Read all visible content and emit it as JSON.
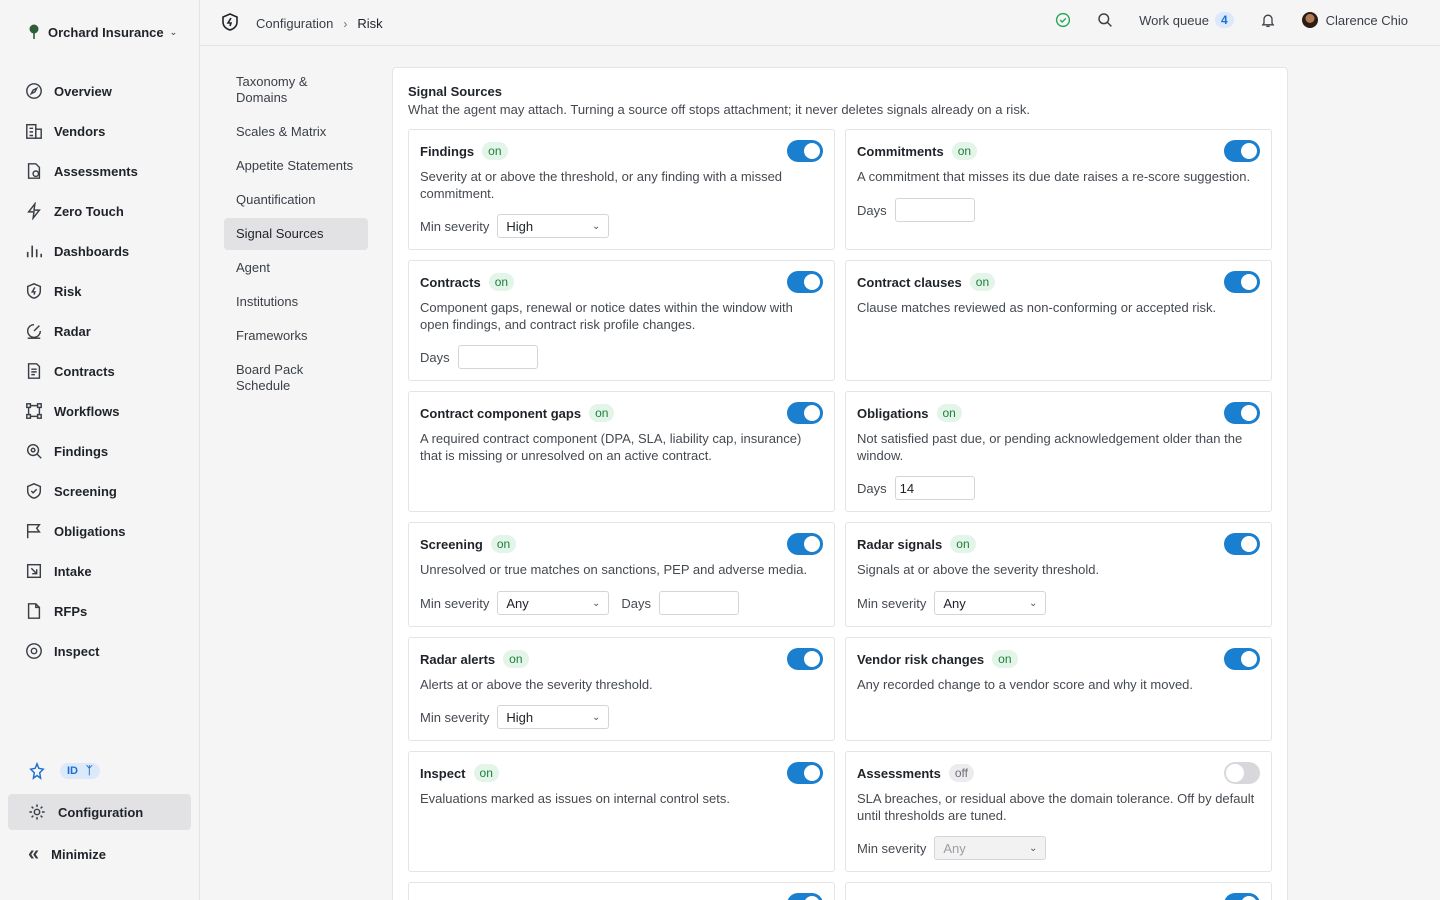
{
  "org": {
    "name": "Orchard Insurance"
  },
  "nav": [
    {
      "label": "Overview",
      "icon": "compass-icon"
    },
    {
      "label": "Vendors",
      "icon": "building-icon"
    },
    {
      "label": "Assessments",
      "icon": "document-check-icon"
    },
    {
      "label": "Zero Touch",
      "icon": "bolt-icon"
    },
    {
      "label": "Dashboards",
      "icon": "bar-chart-icon"
    },
    {
      "label": "Risk",
      "icon": "shield-bolt-icon"
    },
    {
      "label": "Radar",
      "icon": "radar-icon"
    },
    {
      "label": "Contracts",
      "icon": "contract-icon"
    },
    {
      "label": "Workflows",
      "icon": "workflow-icon"
    },
    {
      "label": "Findings",
      "icon": "magnifier-icon"
    },
    {
      "label": "Screening",
      "icon": "shield-check-icon"
    },
    {
      "label": "Obligations",
      "icon": "flag-icon"
    },
    {
      "label": "Intake",
      "icon": "intake-icon"
    },
    {
      "label": "RFPs",
      "icon": "file-icon"
    },
    {
      "label": "Inspect",
      "icon": "eye-icon"
    }
  ],
  "footer": {
    "id_badge": "ID",
    "configuration": "Configuration",
    "minimize": "Minimize"
  },
  "breadcrumb": {
    "parent": "Configuration",
    "current": "Risk"
  },
  "topbar": {
    "work_queue": "Work queue",
    "work_queue_count": "4",
    "user_name": "Clarence Chio"
  },
  "subnav": [
    {
      "label": "Taxonomy & Domains",
      "active": false
    },
    {
      "label": "Scales & Matrix",
      "active": false
    },
    {
      "label": "Appetite Statements",
      "active": false
    },
    {
      "label": "Quantification",
      "active": false
    },
    {
      "label": "Signal Sources",
      "active": true
    },
    {
      "label": "Agent",
      "active": false
    },
    {
      "label": "Institutions",
      "active": false
    },
    {
      "label": "Frameworks",
      "active": false
    },
    {
      "label": "Board Pack Schedule",
      "active": false
    }
  ],
  "panel": {
    "title": "Signal Sources",
    "description": "What the agent may attach. Turning a source off stops attachment; it never deletes signals already on a risk."
  },
  "labels": {
    "min_severity": "Min severity",
    "days": "Days"
  },
  "cards": {
    "findings": {
      "title": "Findings",
      "status": "on",
      "description": "Severity at or above the threshold, or any finding with a missed commitment.",
      "min_severity": "High"
    },
    "commitments": {
      "title": "Commitments",
      "status": "on",
      "description": "A commitment that misses its due date raises a re-score suggestion.",
      "days": ""
    },
    "contracts": {
      "title": "Contracts",
      "status": "on",
      "description": "Component gaps, renewal or notice dates within the window with open findings, and contract risk profile changes.",
      "days": ""
    },
    "contract_clauses": {
      "title": "Contract clauses",
      "status": "on",
      "description": "Clause matches reviewed as non-conforming or accepted risk."
    },
    "contract_component_gaps": {
      "title": "Contract component gaps",
      "status": "on",
      "description": "A required contract component (DPA, SLA, liability cap, insurance) that is missing or unresolved on an active contract."
    },
    "obligations": {
      "title": "Obligations",
      "status": "on",
      "description": "Not satisfied past due, or pending acknowledgement older than the window.",
      "days": "14"
    },
    "screening": {
      "title": "Screening",
      "status": "on",
      "description": "Unresolved or true matches on sanctions, PEP and adverse media.",
      "min_severity": "Any",
      "days": ""
    },
    "radar_signals": {
      "title": "Radar signals",
      "status": "on",
      "description": "Signals at or above the severity threshold.",
      "min_severity": "Any"
    },
    "radar_alerts": {
      "title": "Radar alerts",
      "status": "on",
      "description": "Alerts at or above the severity threshold.",
      "min_severity": "High"
    },
    "vendor_risk_changes": {
      "title": "Vendor risk changes",
      "status": "on",
      "description": "Any recorded change to a vendor score and why it moved."
    },
    "inspect": {
      "title": "Inspect",
      "status": "on",
      "description": "Evaluations marked as issues on internal control sets."
    },
    "assessments": {
      "title": "Assessments",
      "status": "off",
      "description": "SLA breaches, or residual above the domain tolerance. Off by default until thresholds are tuned.",
      "min_severity": "Any"
    }
  },
  "colors": {
    "accent": "#1a7fcf",
    "on_bg": "#e3f4e8",
    "on_text": "#1e7f3c",
    "badge_blue": "#dbe9fb"
  }
}
